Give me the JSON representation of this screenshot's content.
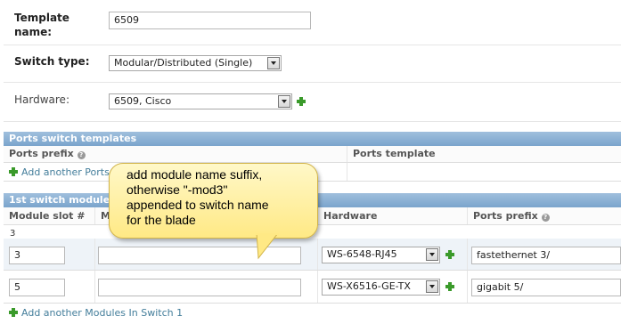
{
  "template_name": {
    "label": "Template name:",
    "value": "6509"
  },
  "switch_type": {
    "label": "Switch type:",
    "value": "Modular/Distributed (Single)"
  },
  "hardware": {
    "label": "Hardware:",
    "value": "6509, Cisco"
  },
  "ports_section": {
    "title": "Ports switch templates",
    "columns": [
      "Ports prefix",
      "Ports template"
    ],
    "add_link": "Add another Ports"
  },
  "modules_section": {
    "title": "1st switch module",
    "columns": [
      "Module slot #",
      "M",
      "Hardware",
      "Ports prefix"
    ],
    "group_label": "3",
    "rows": [
      {
        "slot": "3",
        "name": "",
        "hardware": "WS-6548-RJ45",
        "ports_prefix": "fastethernet 3/"
      },
      {
        "slot": "5",
        "name": "",
        "hardware": "WS-X6516-GE-TX",
        "ports_prefix": "gigabit 5/"
      }
    ],
    "add_link": "Add another Modules In Switch 1"
  },
  "callout": {
    "lines": [
      "add module name suffix,",
      "otherwise \"-mod3\"",
      "appended to switch name",
      "for the blade"
    ]
  },
  "colors": {
    "section_header": "#7aa4cc",
    "link": "#447e9b",
    "add_icon": "#3a9a2a",
    "callout": "#ffe985"
  }
}
